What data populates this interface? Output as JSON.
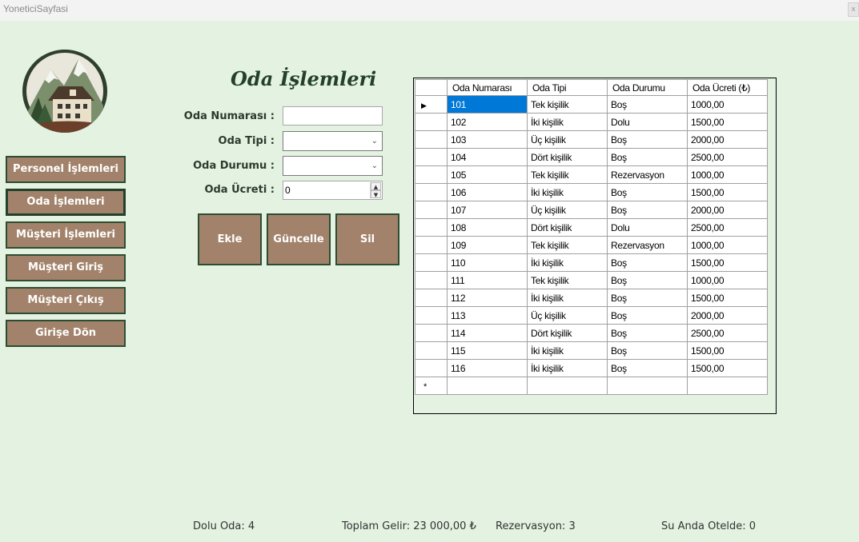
{
  "window": {
    "title": "YoneticiSayfasi",
    "close_label": "x"
  },
  "sidebar": {
    "items": [
      {
        "label": "Personel İşlemleri"
      },
      {
        "label": "Oda İşlemleri"
      },
      {
        "label": "Müşteri İşlemleri"
      },
      {
        "label": "Müşteri Giriş"
      },
      {
        "label": "Müşteri Çıkış"
      },
      {
        "label": "Girişe Dön"
      }
    ]
  },
  "form": {
    "title": "Oda İşlemleri",
    "room_number_label": "Oda Numarası :",
    "room_number_value": "",
    "room_type_label": "Oda Tipi :",
    "room_type_value": "",
    "room_status_label": "Oda Durumu :",
    "room_status_value": "",
    "room_price_label": "Oda Ücreti :",
    "room_price_value": "0",
    "buttons": {
      "add": "Ekle",
      "update": "Güncelle",
      "delete": "Sil"
    }
  },
  "grid": {
    "columns": [
      "Oda Numarası",
      "Oda Tipi",
      "Oda Durumu",
      "Oda Ücreti (₺)"
    ],
    "rows": [
      [
        "101",
        "Tek kişilik",
        "Boş",
        "1000,00"
      ],
      [
        "102",
        "İki kişilik",
        "Dolu",
        "1500,00"
      ],
      [
        "103",
        "Üç kişilik",
        "Boş",
        "2000,00"
      ],
      [
        "104",
        "Dört kişilik",
        "Boş",
        "2500,00"
      ],
      [
        "105",
        "Tek kişilik",
        "Rezervasyon",
        "1000,00"
      ],
      [
        "106",
        "İki kişilik",
        "Boş",
        "1500,00"
      ],
      [
        "107",
        "Üç kişilik",
        "Boş",
        "2000,00"
      ],
      [
        "108",
        "Dört kişilik",
        "Dolu",
        "2500,00"
      ],
      [
        "109",
        "Tek kişilik",
        "Rezervasyon",
        "1000,00"
      ],
      [
        "110",
        "İki kişilik",
        "Boş",
        "1500,00"
      ],
      [
        "111",
        "Tek kişilik",
        "Boş",
        "1000,00"
      ],
      [
        "112",
        "İki kişilik",
        "Boş",
        "1500,00"
      ],
      [
        "113",
        "Üç kişilik",
        "Boş",
        "2000,00"
      ],
      [
        "114",
        "Dört kişilik",
        "Boş",
        "2500,00"
      ],
      [
        "115",
        "İki kişilik",
        "Boş",
        "1500,00"
      ],
      [
        "116",
        "İki kişilik",
        "Boş",
        "1500,00"
      ]
    ],
    "current_row_marker": "▶",
    "new_row_marker": "*"
  },
  "stats": {
    "occupied": "Dolu Oda: 4",
    "total_income": "Toplam Gelir: 23 000,00 ₺",
    "reservations": "Rezervasyon: 3",
    "in_hotel": "Su Anda Otelde: 0"
  },
  "colors": {
    "background": "#e3f2e1",
    "button": "#a2826a",
    "button_border": "#2d4d33",
    "selection": "#0078d7"
  }
}
